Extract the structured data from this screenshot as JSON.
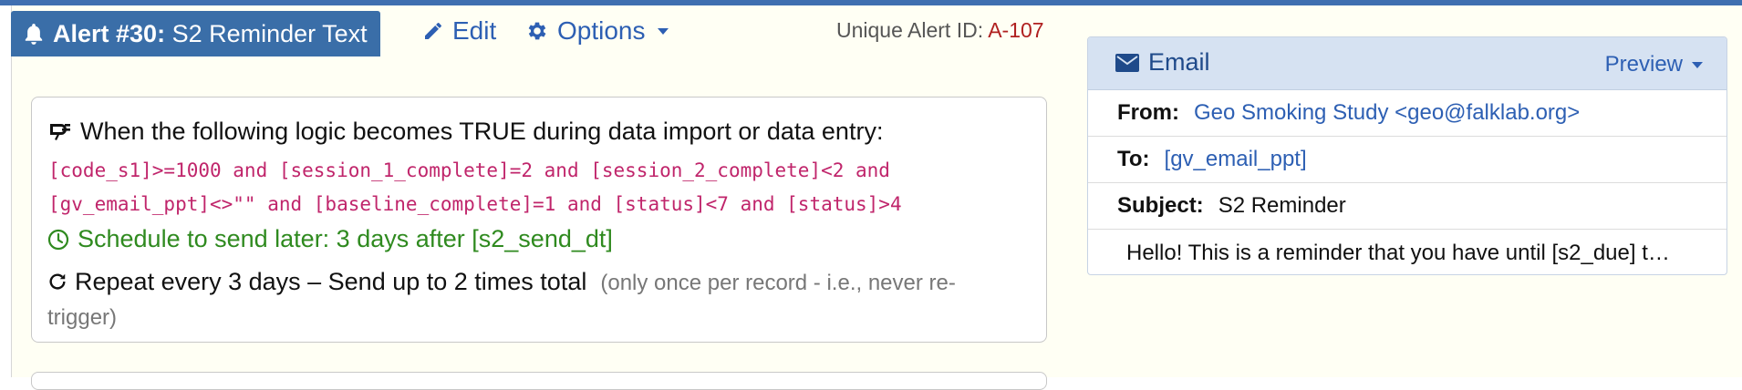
{
  "alert": {
    "title_prefix": "Alert #30:",
    "title_name": "S2 Reminder Text",
    "edit_label": "Edit",
    "options_label": "Options",
    "uid_label": "Unique Alert ID:",
    "uid_value": "A-107"
  },
  "logic": {
    "trigger_text": "When the following logic becomes TRUE during data import or data entry:",
    "code": "[code_s1]>=1000 and [session_1_complete]=2 and [session_2_complete]<2 and [gv_email_ppt]<>\"\" and [baseline_complete]=1 and [status]<7 and [status]>4",
    "schedule": "Schedule to send later: 3 days after [s2_send_dt]",
    "repeat": "Repeat every 3 days – Send up to 2 times total",
    "repeat_note": "(only once per record - i.e., never re-trigger)"
  },
  "email": {
    "title": "Email",
    "preview_label": "Preview",
    "from_label": "From:",
    "from_value": "Geo Smoking Study <geo@falklab.org>",
    "to_label": "To:",
    "to_value": "[gv_email_ppt]",
    "subject_label": "Subject:",
    "subject_value": "S2 Reminder",
    "body_preview": "Hello! This is a reminder that you have until [s2_due] t…"
  },
  "colors": {
    "title_bg": "#3a6ea8",
    "link": "#2d5fb3",
    "logic_code": "#c0256b",
    "schedule_green": "#2f8a1f",
    "uid_red": "#b02020",
    "email_header_bg": "#d6e2f2"
  },
  "icons": [
    "bell-icon",
    "pencil-icon",
    "gear-icon",
    "chevron-down-icon",
    "logic-icon",
    "clock-icon",
    "redo-icon",
    "envelope-icon"
  ]
}
